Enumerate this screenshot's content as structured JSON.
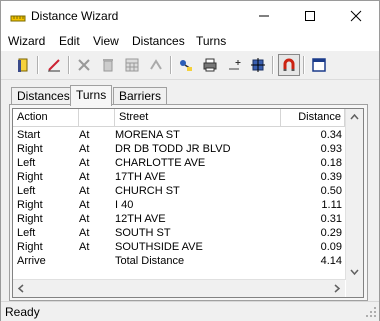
{
  "window": {
    "title": "Distance Wizard"
  },
  "menu": [
    "Wizard",
    "Edit",
    "View",
    "Distances",
    "Turns"
  ],
  "toolbar": {
    "icons": [
      "file-icon",
      "edit-pencil-icon",
      "delete-icon",
      "clear-icon",
      "calculator-icon",
      "merge-icon",
      "route-icon",
      "print-icon",
      "plus-icon",
      "move-icon",
      "magnet-icon",
      "window-icon"
    ]
  },
  "tabs": [
    "Distances",
    "Turns",
    "Barriers"
  ],
  "active_tab": "Turns",
  "table": {
    "columns": [
      "Action",
      "",
      "Street",
      "Distance"
    ],
    "rows": [
      {
        "action": "Start",
        "at": "At",
        "street": "MORENA ST",
        "distance": "0.34"
      },
      {
        "action": "Right",
        "at": "At",
        "street": "DR DB TODD JR BLVD",
        "distance": "0.93"
      },
      {
        "action": "Left",
        "at": "At",
        "street": "CHARLOTTE AVE",
        "distance": "0.18"
      },
      {
        "action": "Right",
        "at": "At",
        "street": "17TH AVE",
        "distance": "0.39"
      },
      {
        "action": "Left",
        "at": "At",
        "street": "CHURCH ST",
        "distance": "0.50"
      },
      {
        "action": "Right",
        "at": "At",
        "street": "I 40",
        "distance": "1.11"
      },
      {
        "action": "Right",
        "at": "At",
        "street": "12TH AVE",
        "distance": "0.31"
      },
      {
        "action": "Left",
        "at": "At",
        "street": "SOUTH ST",
        "distance": "0.29"
      },
      {
        "action": "Right",
        "at": "At",
        "street": "SOUTHSIDE AVE",
        "distance": "0.09"
      },
      {
        "action": "Arrive",
        "at": "",
        "street": "Total Distance",
        "distance": "4.14"
      }
    ]
  },
  "status": {
    "text": "Ready"
  }
}
